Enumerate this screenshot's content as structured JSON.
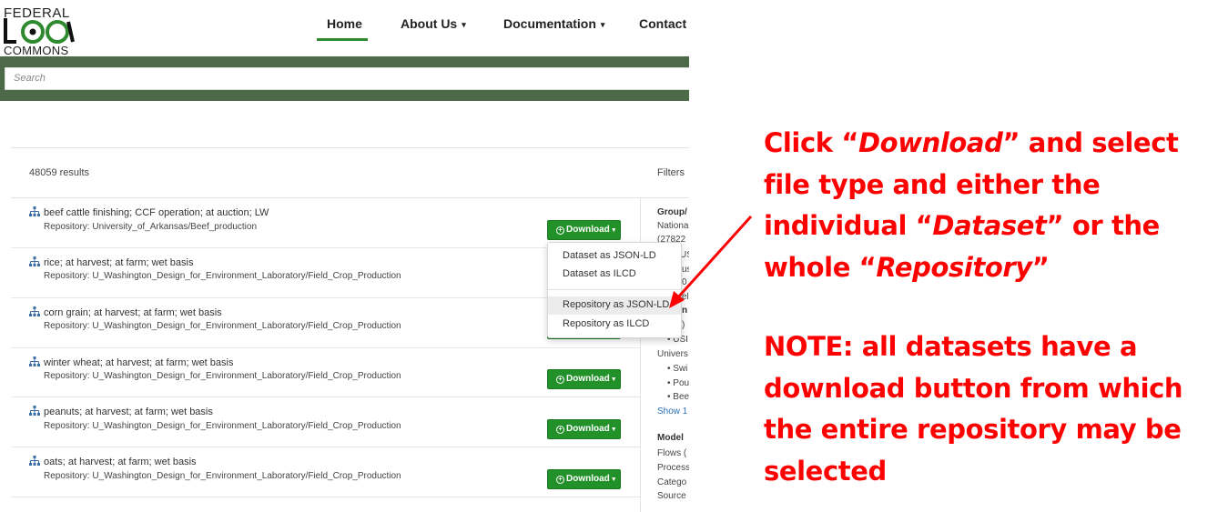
{
  "logo": {
    "top": "FEDERAL",
    "mid": "LCA",
    "bottom": "COMMONS"
  },
  "nav": {
    "home": "Home",
    "about": "About Us",
    "docs": "Documentation",
    "contact": "Contact",
    "caret": "▾"
  },
  "search": {
    "placeholder": "Search"
  },
  "results": {
    "count": "48059 results",
    "filters": "Filters"
  },
  "download_label": "Download",
  "items": [
    {
      "title": "beef cattle finishing; CCF operation; at auction; LW",
      "repo": "Repository: University_of_Arkansas/Beef_production"
    },
    {
      "title": "rice; at harvest; at farm; wet basis",
      "repo": "Repository: U_Washington_Design_for_Environment_Laboratory/Field_Crop_Production"
    },
    {
      "title": "corn grain; at harvest; at farm; wet basis",
      "repo": "Repository: U_Washington_Design_for_Environment_Laboratory/Field_Crop_Production"
    },
    {
      "title": "winter wheat; at harvest; at farm; wet basis",
      "repo": "Repository: U_Washington_Design_for_Environment_Laboratory/Field_Crop_Production"
    },
    {
      "title": "peanuts; at harvest; at farm; wet basis",
      "repo": "Repository: U_Washington_Design_for_Environment_Laboratory/Field_Crop_Production"
    },
    {
      "title": "oats; at harvest; at farm; wet basis",
      "repo": "Repository: U_Washington_Design_for_Environment_Laboratory/Field_Crop_Production"
    }
  ],
  "dropdown": {
    "dataset_jsonld": "Dataset as JSON-LD",
    "dataset_ilcd": "Dataset as ILCD",
    "repo_jsonld": "Repository as JSON-LD",
    "repo_ilcd": "Repository as ILCD"
  },
  "sidebar": {
    "group": "Group/",
    "national": "Nationa",
    "count": "(27822",
    "s1": "USI",
    "s2": "us",
    "s3": "0",
    "s4": "el",
    "s5": "n",
    "s6": ")",
    "s7": "• USI",
    "univ": "Univers",
    "swi": "• Swi",
    "pou": "• Pou",
    "bee": "• Bee",
    "show": "Show 1",
    "model": "Model",
    "flows": "Flows (",
    "process": "Process",
    "category": "Catego",
    "source": "Source"
  },
  "annotation": {
    "line1": "Click “",
    "line1_em": "Download",
    "line1_end": "” and select",
    "line2": "file type and either the",
    "line3": "individual “",
    "line3_em": "Dataset",
    "line3_end": "” or the",
    "line4": "whole “",
    "line4_em": "Repository",
    "line4_end": "”",
    "note1": "NOTE: all datasets have a",
    "note2": "download button from which",
    "note3": "the entire repository may be",
    "note4": "selected"
  },
  "colors": {
    "accent_green": "#23912a",
    "header_bar": "#4c6a47",
    "annotation": "#ff0000",
    "link": "#2a6fb5"
  }
}
